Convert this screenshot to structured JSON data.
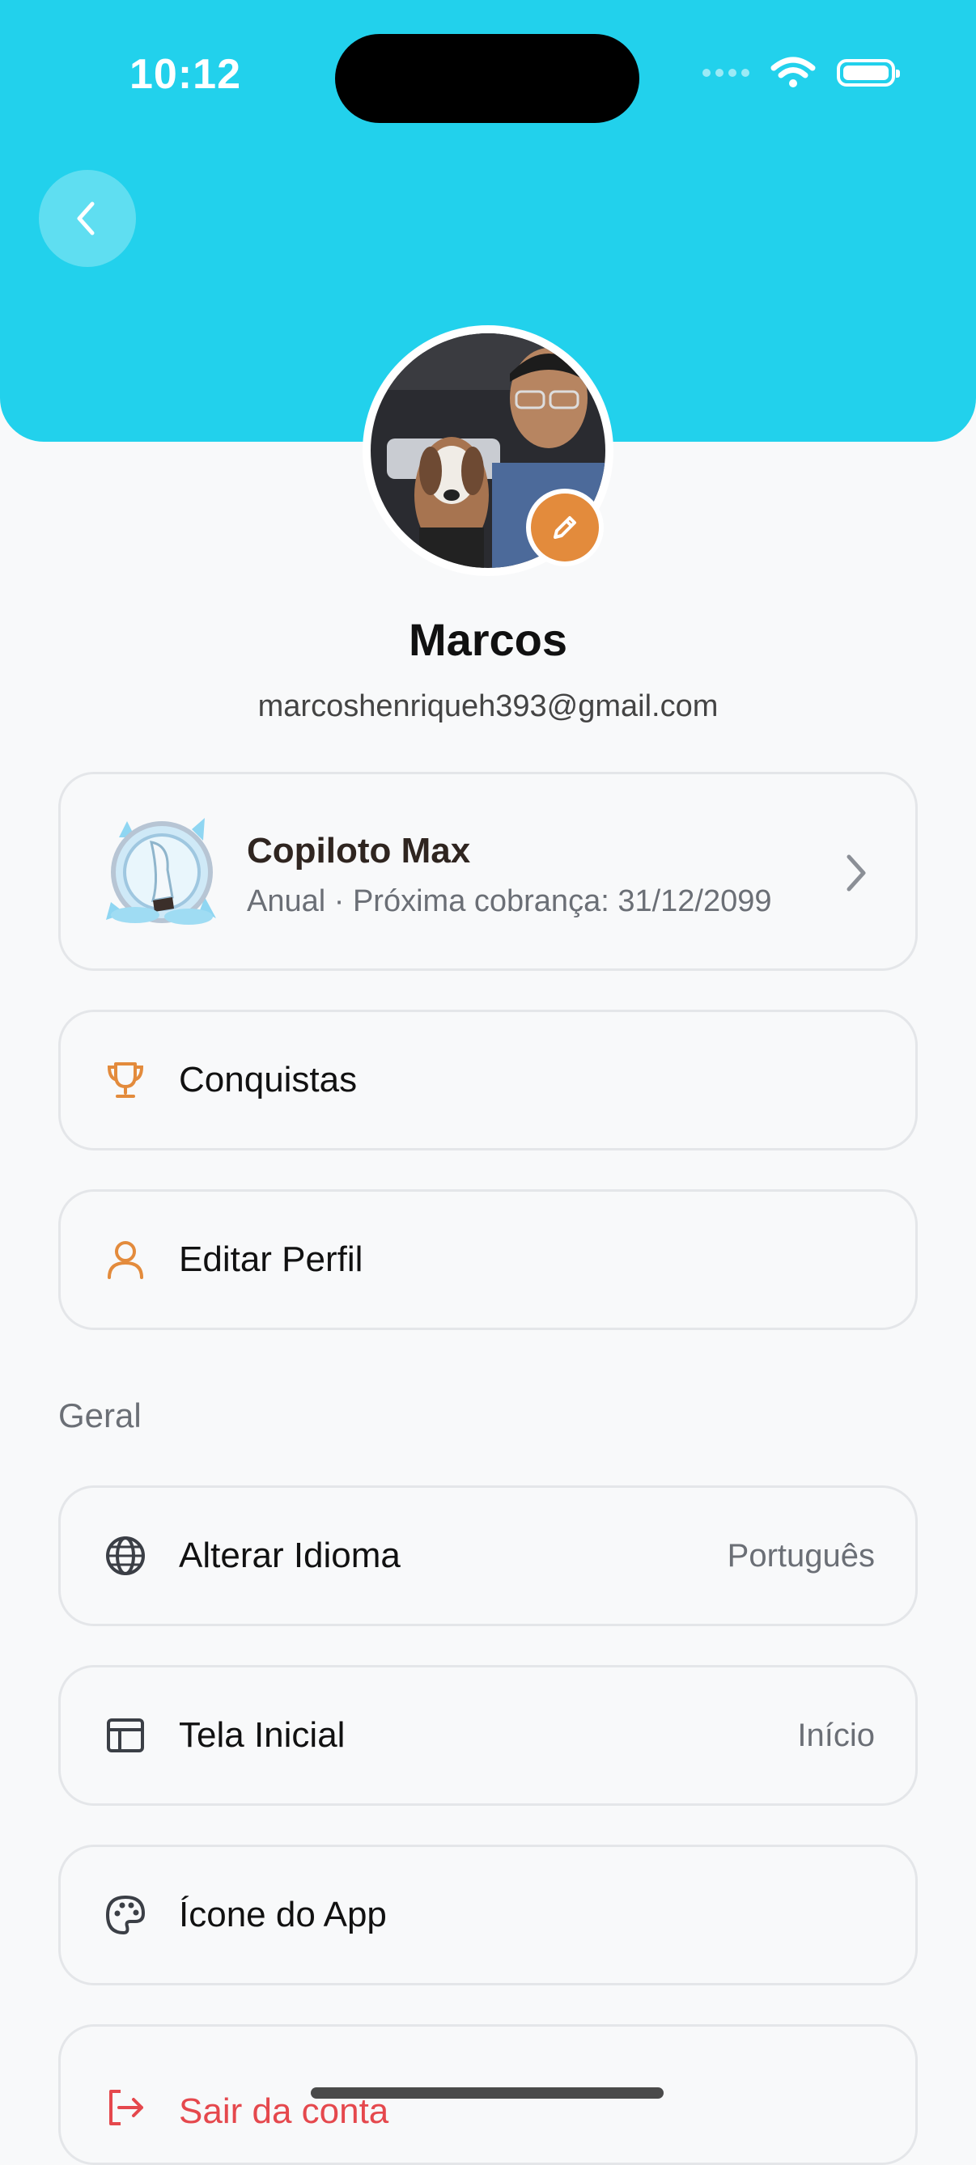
{
  "status_bar": {
    "time": "10:12"
  },
  "header": {
    "back_icon": "chevron-left-icon",
    "color": "#22d1ec"
  },
  "profile": {
    "name": "Marcos",
    "email": "marcoshenriqueh393@gmail.com",
    "edit_icon": "pencil-icon",
    "edit_color": "#e38b3c"
  },
  "subscription": {
    "title": "Copiloto Max",
    "detail": "Anual · Próxima cobrança: 31/12/2099",
    "badge_icon": "crystal-badge-icon"
  },
  "menu": {
    "achievements": {
      "label": "Conquistas",
      "icon": "trophy-icon"
    },
    "edit_profile": {
      "label": "Editar Perfil",
      "icon": "user-icon"
    }
  },
  "general": {
    "title": "Geral",
    "language": {
      "label": "Alterar Idioma",
      "value": "Português",
      "icon": "globe-icon"
    },
    "home_screen": {
      "label": "Tela Inicial",
      "value": "Início",
      "icon": "layout-icon"
    },
    "app_icon": {
      "label": "Ícone do App",
      "icon": "palette-icon"
    },
    "logout": {
      "label": "Sair da conta",
      "icon": "logout-icon",
      "color": "#e5484d"
    }
  },
  "colors": {
    "accent": "#e38b3c",
    "danger": "#e5484d",
    "background": "#f8f9fa"
  }
}
